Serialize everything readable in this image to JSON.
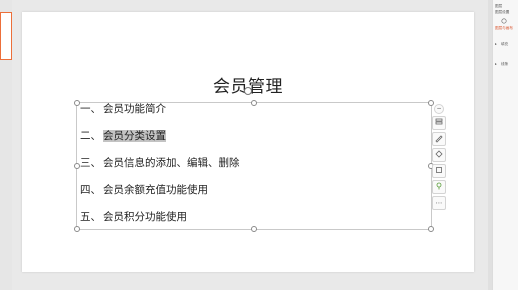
{
  "slide": {
    "title": "会员管理",
    "outline": [
      {
        "num": "一、",
        "text": "会员功能简介"
      },
      {
        "num": "二、",
        "text": "会员分类设置"
      },
      {
        "num": "三、",
        "text": "会员信息的添加、编辑、删除"
      },
      {
        "num": "四、",
        "text": "会员余额充值功能使用"
      },
      {
        "num": "五、",
        "text": "会员积分功能使用"
      }
    ]
  },
  "right_pane": {
    "top_label": "图层",
    "sub_label": "图层设置",
    "accent_label": "图层与画布",
    "section_1": "填充",
    "section_2": "线条"
  },
  "colors": {
    "accent": "#d9532c",
    "thumbnail_border": "#ec6f3a",
    "highlight": "#c3c3c3"
  }
}
